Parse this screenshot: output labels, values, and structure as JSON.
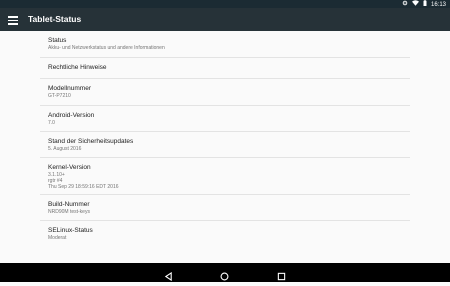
{
  "status_bar": {
    "time": "16:13",
    "icons": [
      "data-sync-icon",
      "wifi-icon",
      "battery-icon"
    ]
  },
  "app_bar": {
    "title": "Tablet-Status",
    "menu_icon": "hamburger-menu-icon"
  },
  "items": [
    {
      "title": "Status",
      "subtitle": "Akku- und Netzwerkstatus und andere Informationen"
    },
    {
      "title": "Rechtliche Hinweise",
      "subtitle": ""
    },
    {
      "title": "Modellnummer",
      "subtitle": "GT-P7210"
    },
    {
      "title": "Android-Version",
      "subtitle": "7.0"
    },
    {
      "title": "Stand der Sicherheitsupdates",
      "subtitle": "5. August 2016"
    },
    {
      "title": "Kernel-Version",
      "subtitle": "3.1.10+\nrgtr #4\nThu Sep 29 18:59:16 EDT 2016"
    },
    {
      "title": "Build-Nummer",
      "subtitle": "NRD90M test-keys"
    },
    {
      "title": "SELinux-Status",
      "subtitle": "Moderat"
    }
  ],
  "nav_bar": {
    "icons": [
      "back-icon",
      "home-icon",
      "recents-icon"
    ]
  }
}
